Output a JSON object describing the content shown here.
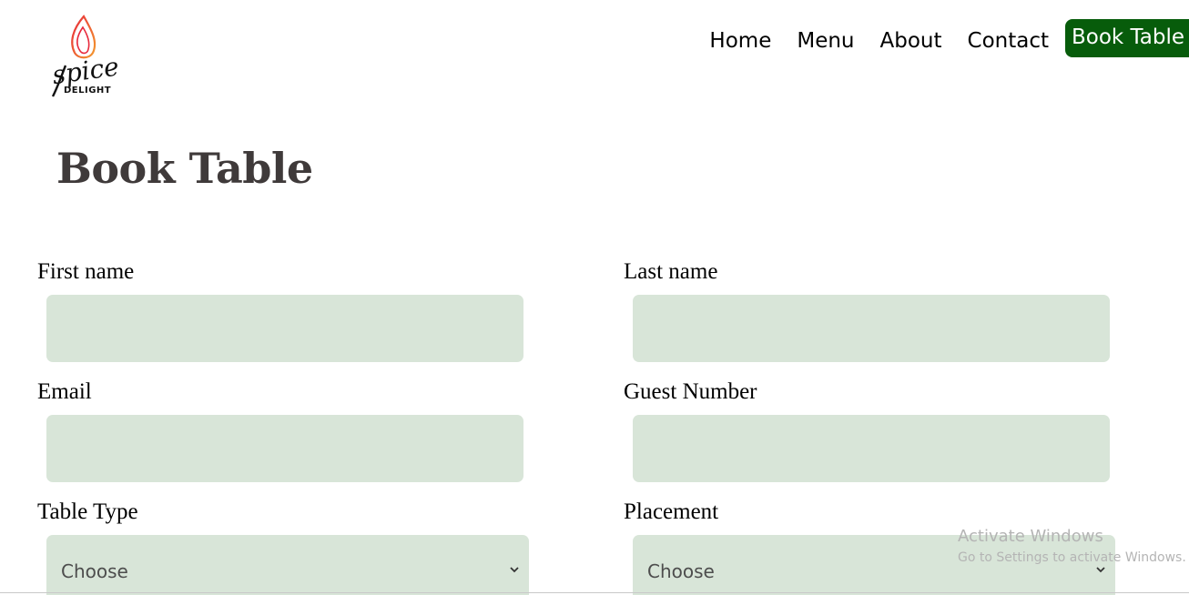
{
  "brand": {
    "logo_word": "spice",
    "logo_sub": "DELIGHT",
    "colors": {
      "flame_red": "#e8283b",
      "flame_orange": "#f39a2e"
    }
  },
  "nav": {
    "items": [
      "Home",
      "Menu",
      "About",
      "Contact"
    ],
    "cta_label": "Book Table",
    "cta_color": "#075c0b"
  },
  "page": {
    "title": "Book Table"
  },
  "form": {
    "first_name_label": "First name",
    "last_name_label": "Last name",
    "email_label": "Email",
    "guest_number_label": "Guest Number",
    "table_type_label": "Table Type",
    "table_type_value": "Choose",
    "placement_label": "Placement",
    "placement_value": "Choose",
    "field_color": "#d8e5d8"
  },
  "watermark": {
    "title": "Activate Windows",
    "subtitle": "Go to Settings to activate Windows."
  }
}
